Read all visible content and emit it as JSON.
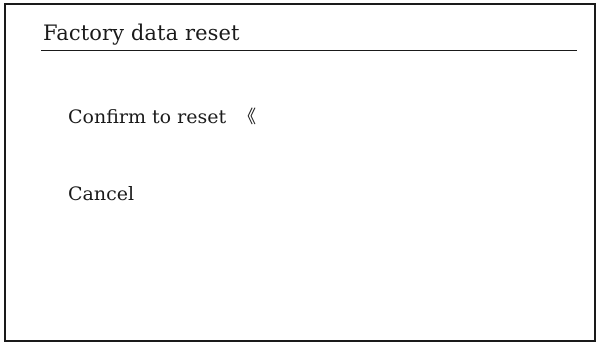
{
  "screen": {
    "title": "Factory data reset",
    "options": [
      {
        "label": "Confirm to reset",
        "selected": true
      },
      {
        "label": "Cancel",
        "selected": false
      }
    ],
    "selection_marker": "《"
  }
}
